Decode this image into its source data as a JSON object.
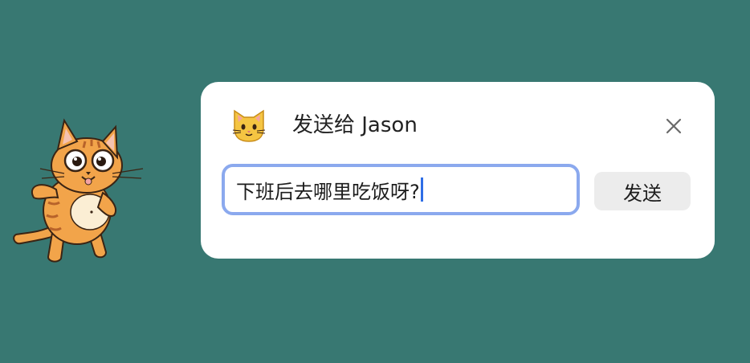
{
  "dialog": {
    "icon": "cat-face-icon",
    "title": "发送给 Jason",
    "close_icon": "close-icon",
    "input": {
      "value": "下班后去哪里吃饭呀?"
    },
    "send_label": "发送"
  },
  "decoration": {
    "mascot": "cartoon-cat"
  },
  "colors": {
    "background": "#387872",
    "dialog_background": "#ffffff",
    "input_focus_border": "#8ba9ee",
    "caret": "#2f6ee6",
    "send_button_background": "#ececec"
  }
}
